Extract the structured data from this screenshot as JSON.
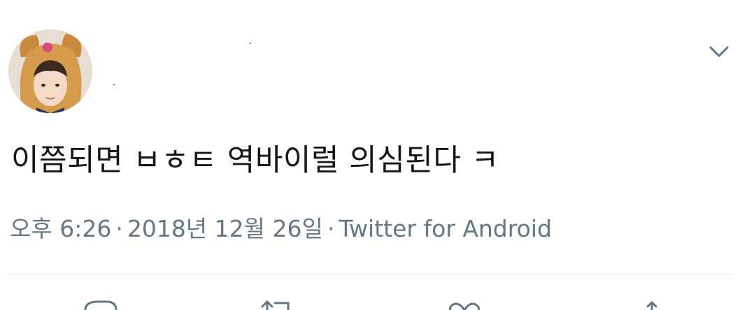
{
  "tweet": {
    "text": "이쯤되면 ㅂㅎㅌ 역바이럴 의심된다 ㅋ",
    "meta": {
      "time": "오후 6:26",
      "separator": "·",
      "date": "2018년 12월 26일",
      "source": "Twitter for Android"
    }
  },
  "icons": {
    "menu": "chevron-down-icon",
    "actions": [
      "reply-icon",
      "retweet-icon",
      "like-icon",
      "share-icon"
    ]
  },
  "colors": {
    "text": "#14171a",
    "meta": "#657786",
    "divider": "#dfe3e7",
    "icon": "#657786"
  }
}
